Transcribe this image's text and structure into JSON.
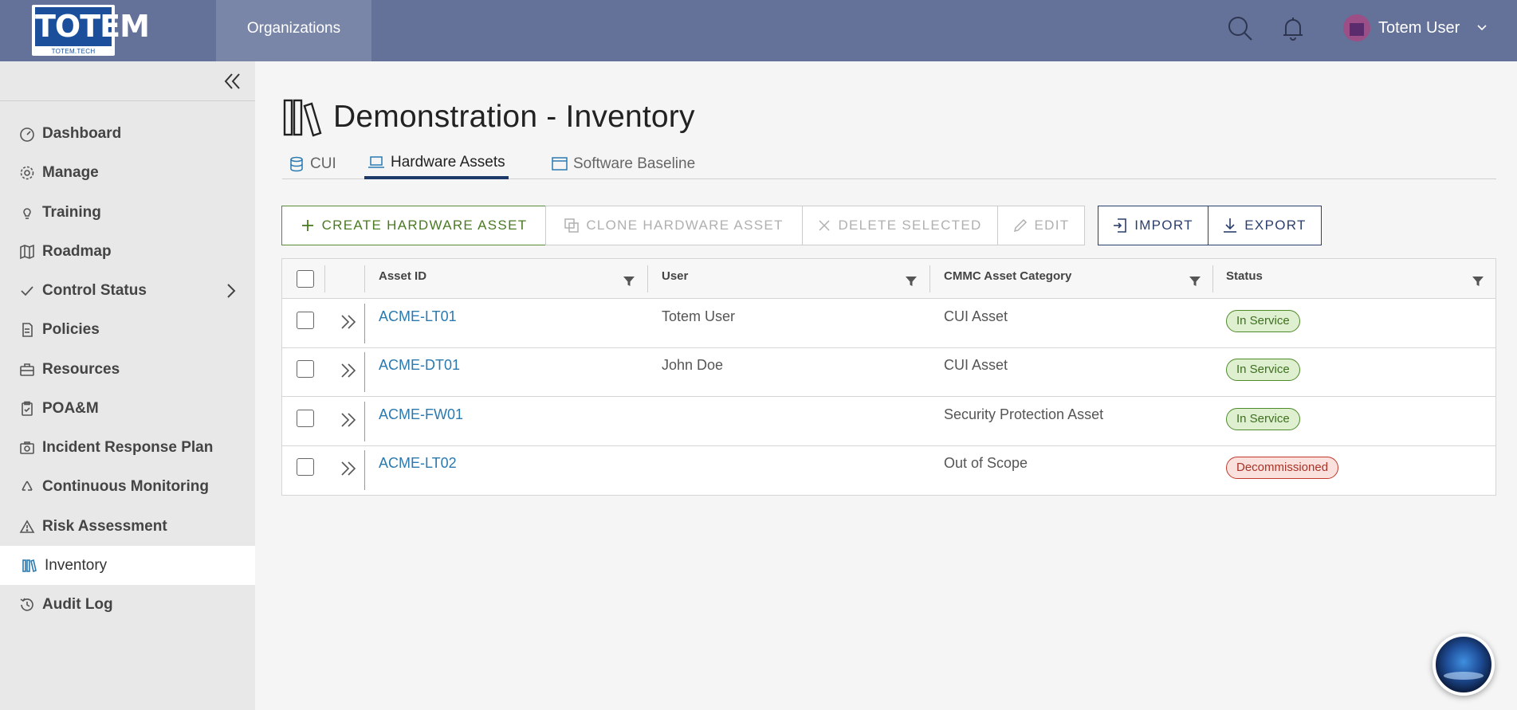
{
  "header": {
    "logo_text": "TOTEM",
    "logo_subtext": "TOTEM.TECH",
    "nav_organizations": "Organizations",
    "user_name": "Totem User"
  },
  "sidebar": {
    "items": [
      {
        "label": "Dashboard",
        "icon": "dashboard-icon"
      },
      {
        "label": "Manage",
        "icon": "gear-icon"
      },
      {
        "label": "Training",
        "icon": "lightbulb-icon"
      },
      {
        "label": "Roadmap",
        "icon": "map-icon"
      },
      {
        "label": "Control Status",
        "icon": "check-icon"
      },
      {
        "label": "Policies",
        "icon": "document-icon"
      },
      {
        "label": "Resources",
        "icon": "briefcase-icon"
      },
      {
        "label": "POA&M",
        "icon": "clipboard-icon"
      },
      {
        "label": "Incident Response Plan",
        "icon": "camera-icon"
      },
      {
        "label": "Continuous Monitoring",
        "icon": "recycle-icon"
      },
      {
        "label": "Risk Assessment",
        "icon": "warning-icon"
      },
      {
        "label": "Inventory",
        "icon": "books-icon"
      },
      {
        "label": "Audit Log",
        "icon": "history-icon"
      }
    ],
    "active": "Inventory"
  },
  "page": {
    "title": "Demonstration - Inventory"
  },
  "tabs": [
    {
      "label": "CUI",
      "icon": "database-icon"
    },
    {
      "label": "Hardware Assets",
      "icon": "laptop-icon"
    },
    {
      "label": "Software Baseline",
      "icon": "window-icon"
    }
  ],
  "active_tab": "Hardware Assets",
  "toolbar": {
    "create": "CREATE HARDWARE ASSET",
    "clone": "CLONE HARDWARE ASSET",
    "delete": "DELETE SELECTED",
    "edit": "EDIT",
    "import": "IMPORT",
    "export": "EXPORT"
  },
  "table": {
    "columns": [
      "Asset ID",
      "User",
      "CMMC Asset Category",
      "Status"
    ],
    "rows": [
      {
        "asset_id": "ACME-LT01",
        "user": "Totem User",
        "category": "CUI Asset",
        "status": "In Service"
      },
      {
        "asset_id": "ACME-DT01",
        "user": "John Doe",
        "category": "CUI Asset",
        "status": "In Service"
      },
      {
        "asset_id": "ACME-FW01",
        "user": "",
        "category": "Security Protection Asset",
        "status": "In Service"
      },
      {
        "asset_id": "ACME-LT02",
        "user": "",
        "category": "Out of Scope",
        "status": "Decommissioned"
      }
    ]
  },
  "colors": {
    "header_bg": "#647199",
    "sidebar_bg": "#e8e8e8",
    "create_green": "#4a7a22",
    "navy": "#2b3f6e",
    "link_blue": "#2a7ab0",
    "status_ok": "#dff0d0",
    "status_bad": "#fbe1de"
  }
}
